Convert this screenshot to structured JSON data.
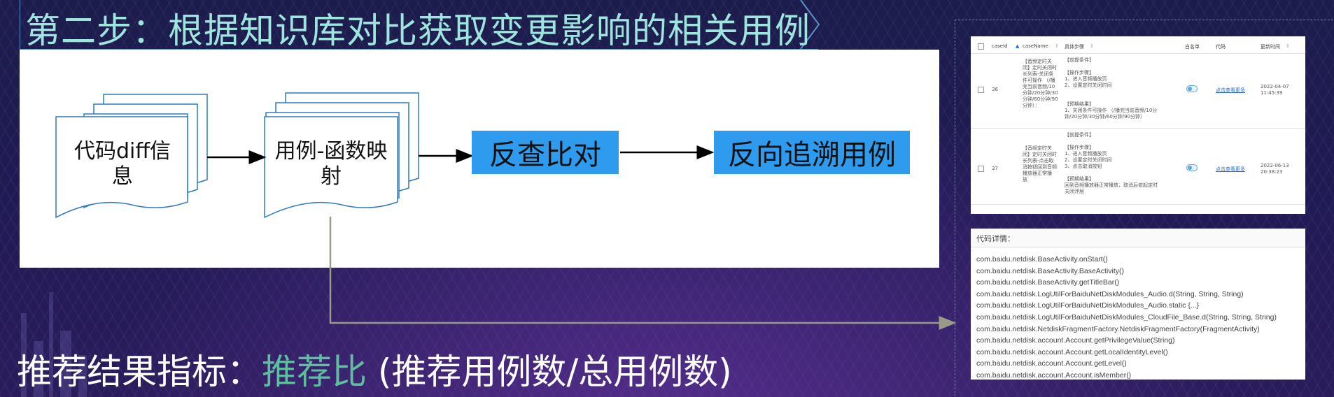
{
  "slide": {
    "title": "第二步：根据知识库对比获取变更影响的相关用例",
    "metric": {
      "label": "推荐结果指标：",
      "highlight": "推荐比",
      "formula": "(推荐用例数/总用例数)"
    }
  },
  "flow": {
    "doc1": "代码diff信息",
    "doc2": "用例-函数映射",
    "box1": "反查比对",
    "box2": "反向追溯用例"
  },
  "table": {
    "headers": {
      "caseid": "caseId",
      "casename": "caseName",
      "steps": "具体步骤",
      "whitelist": "白名单",
      "code": "代码",
      "updated": "更新时间"
    },
    "rows": [
      {
        "id": "36",
        "name_lines": [
          "【音频定时关",
          "闭】定时关闭时",
          "长列表-关闭条",
          "件可操作 （/播",
          "完当前音频/10",
          "分钟/20分钟/30",
          "分钟/60分钟/90",
          "分钟）："
        ],
        "step_lines": [
          "【前提条件】",
          "",
          "【操作步骤】",
          "1、进入音频播放页",
          "2、设置定时关闭时间",
          "",
          "",
          "【预期结果】",
          "1、关闭条件可操作 （/播完当前音频/10分",
          "钟/20分钟/30分钟/60分钟/90分钟）"
        ],
        "code_link": "点击查看更多",
        "date": "2022-04-07",
        "time": "11:45:39"
      },
      {
        "id": "37",
        "name_lines": [
          "【音频定时关",
          "闭】定时关闭时",
          "长列表-点击取",
          "消按钮回到音频",
          "播放器正常播",
          "放"
        ],
        "step_lines": [
          "【前提条件】",
          "",
          "【操作步骤】",
          "1、进入音频播放页",
          "2、设置定时关闭时间",
          "3、点击取消按钮",
          "",
          "【预期结果】",
          "回到音频播放器正常播放，取消后依起定时",
          "关闭浮层"
        ],
        "code_link": "点击查看更多",
        "date": "2022-06-13",
        "time": "20:38:23"
      }
    ]
  },
  "code_details": {
    "title": "代码详情：",
    "lines": [
      "com.baidu.netdisk.BaseActivity.onStart()",
      "com.baidu.netdisk.BaseActivity.BaseActivity()",
      "com.baidu.netdisk.BaseActivity.getTitleBar()",
      "com.baidu.netdisk.LogUtilForBaiduNetDiskModules_Audio.d(String, String, String)",
      "com.baidu.netdisk.LogUtilForBaiduNetDiskModules_Audio.static {...}",
      "com.baidu.netdisk.LogUtilForBaiduNetDiskModules_CloudFile_Base.d(String, String, String)",
      "com.baidu.netdisk.NetdiskFragmentFactory.NetdiskFragmentFactory(FragmentActivity)",
      "com.baidu.netdisk.account.Account.getPrivilegeValue(String)",
      "com.baidu.netdisk.account.Account.getLocalIdentityLevel()",
      "com.baidu.netdisk.account.Account.getLevel()",
      "com.baidu.netdisk.account.Account.isMember()"
    ]
  },
  "colors": {
    "title": "#9fe4df",
    "highlight": "#5fbe9f",
    "blue_box": "#2e9bef"
  }
}
